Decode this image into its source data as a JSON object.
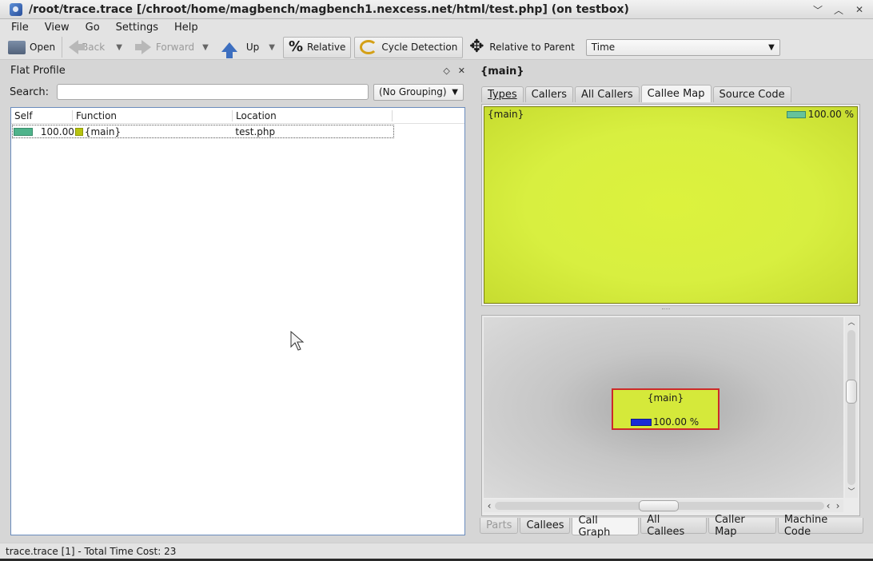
{
  "window": {
    "title": "/root/trace.trace [/chroot/home/magbench/magbench1.nexcess.net/html/test.php] (on testbox)"
  },
  "menu": [
    "File",
    "View",
    "Go",
    "Settings",
    "Help"
  ],
  "toolbar": {
    "open": "Open",
    "back": "Back",
    "forward": "Forward",
    "up": "Up",
    "relative": "Relative",
    "cycle_detection": "Cycle Detection",
    "relative_to_parent": "Relative to Parent",
    "event_type": "Time"
  },
  "flat_profile": {
    "title": "Flat Profile",
    "search_label": "Search:",
    "search_value": "",
    "grouping": "(No Grouping)",
    "columns": [
      "Self",
      "Function",
      "Location"
    ],
    "rows": [
      {
        "self": "100.00",
        "self_fraction": 1.0,
        "function": "{main}",
        "location": "test.php"
      }
    ]
  },
  "detail": {
    "function_title": "{main}",
    "upper_tabs": [
      "Types",
      "Callers",
      "All Callers",
      "Callee Map",
      "Source Code"
    ],
    "upper_active_tab": "Callee Map",
    "callee_map": {
      "label": "{main}",
      "percent": "100.00 %"
    },
    "call_graph": {
      "node_label": "{main}",
      "node_percent": "100.00 %"
    },
    "lower_tabs": [
      "Parts",
      "Callees",
      "Call Graph",
      "All Callees",
      "Caller Map",
      "Machine Code"
    ],
    "lower_active_tab": "Call Graph"
  },
  "status": {
    "text": "trace.trace [1] - Total Time Cost: 23"
  },
  "colors": {
    "map_fill": "#dcf23d",
    "node_border": "#cc2a2a",
    "percent_bar_green": "#66c29b",
    "percent_bar_blue": "#1a2bd6",
    "function_swatch": "#b7c410",
    "list_border": "#6a8cbd"
  }
}
